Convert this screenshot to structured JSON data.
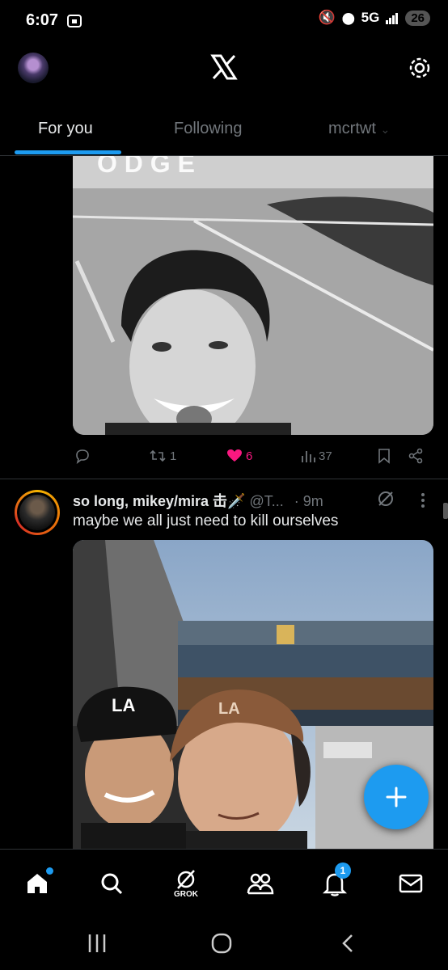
{
  "status_bar": {
    "time": "6:07",
    "network": "5G",
    "battery": "26"
  },
  "header": {
    "logo": "X"
  },
  "tabs": [
    {
      "label": "For you",
      "active": true
    },
    {
      "label": "Following",
      "active": false
    },
    {
      "label": "mcrtwt",
      "active": false
    }
  ],
  "post1": {
    "image_desc": "black-and-white selfie",
    "actions": {
      "replies": "",
      "reposts": "1",
      "likes": "6",
      "views": "37"
    }
  },
  "post2": {
    "name": "so long, mikey/mira 击🗡️",
    "handle": "@T...",
    "time": "· 9m",
    "text": "maybe we all just need to kill ourselves",
    "image_desc": "two people taking a selfie in a stadium"
  },
  "bottom_nav": {
    "grok_label": "GROK",
    "notifications_badge": "1"
  },
  "colors": {
    "accent": "#1d9bf0",
    "like": "#f91880",
    "muted": "#71767b"
  }
}
